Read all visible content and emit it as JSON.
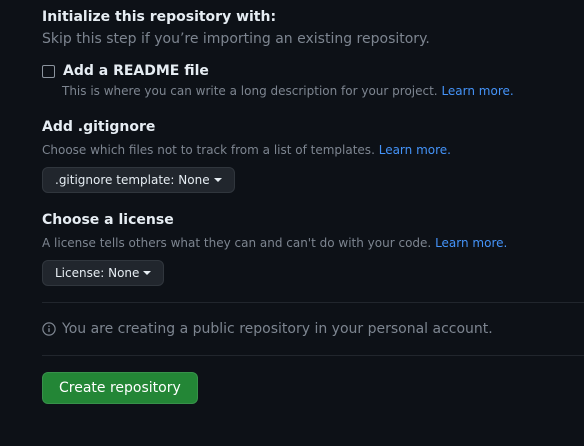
{
  "init": {
    "title": "Initialize this repository with:",
    "subtitle": "Skip this step if you’re importing an existing repository."
  },
  "readme": {
    "label": "Add a README file",
    "description": "This is where you can write a long description for your project.",
    "link": "Learn more.",
    "checked": false
  },
  "gitignore": {
    "title": "Add .gitignore",
    "description": "Choose which files not to track from a list of templates.",
    "link": "Learn more.",
    "dropdown_label": ".gitignore template: None"
  },
  "license": {
    "title": "Choose a license",
    "description": "A license tells others what they can and can't do with your code.",
    "link": "Learn more.",
    "dropdown_label": "License: None"
  },
  "notice": {
    "text": "You are creating a public repository in your personal account.",
    "icon": "info-icon"
  },
  "create": {
    "button_label": "Create repository"
  },
  "colors": {
    "background": "#0d1117",
    "link": "#4493f8",
    "primary_button": "#238636"
  }
}
